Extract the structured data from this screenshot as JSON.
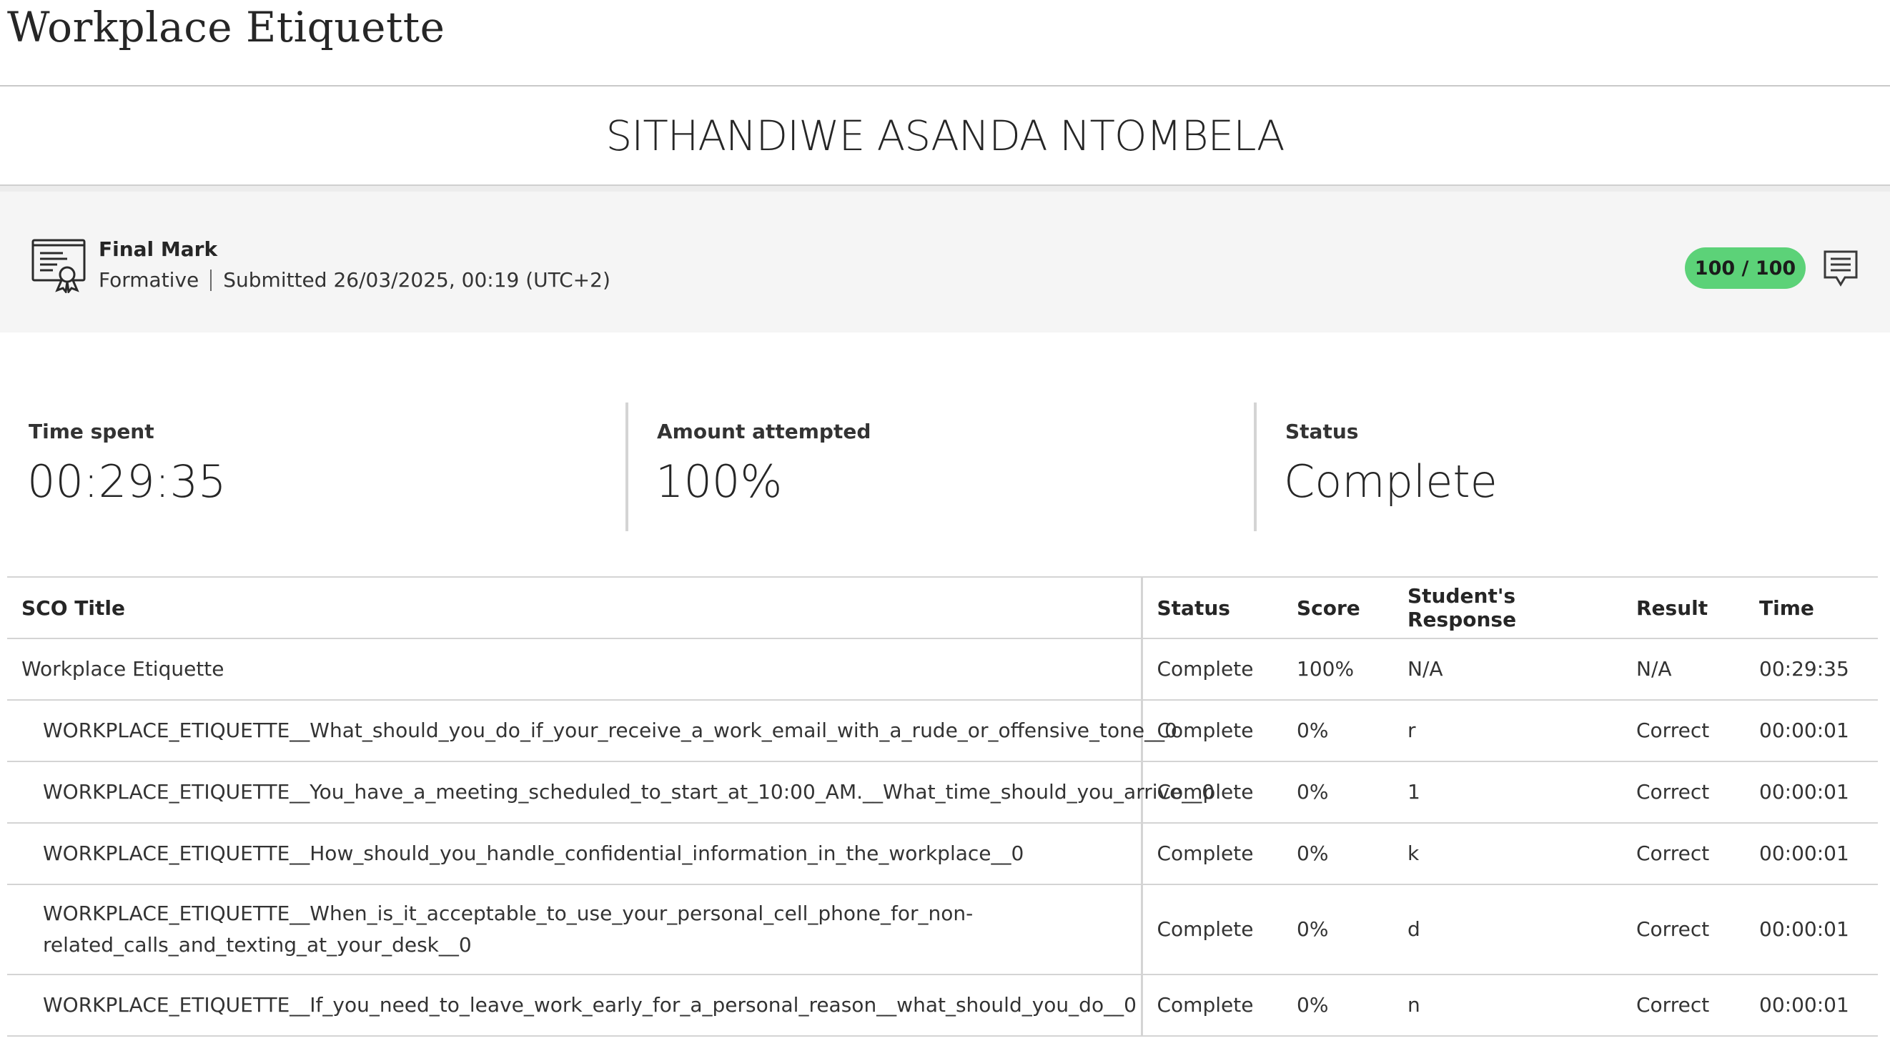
{
  "page": {
    "title": "Workplace Etiquette"
  },
  "student": {
    "name": "SITHANDIWE ASANDA NTOMBELA"
  },
  "final_mark": {
    "label": "Final Mark",
    "type": "Formative",
    "submitted": "Submitted 26/03/2025, 00:19 (UTC+2)",
    "score": "100 / 100",
    "score_color": "#5cd278"
  },
  "stats": {
    "time_spent": {
      "label": "Time spent",
      "value": "00:29:35"
    },
    "amount_attempted": {
      "label": "Amount attempted",
      "value": "100%"
    },
    "status": {
      "label": "Status",
      "value": "Complete"
    }
  },
  "table": {
    "headers": {
      "sco_title": "SCO Title",
      "status": "Status",
      "score": "Score",
      "response": "Student's Response",
      "result": "Result",
      "time": "Time"
    },
    "rows": [
      {
        "title": "Workplace Etiquette",
        "status": "Complete",
        "score": "100%",
        "response": "N/A",
        "result": "N/A",
        "time": "00:29:35"
      },
      {
        "title": "WORKPLACE_ETIQUETTE__What_should_you_do_if_your_receive_a_work_email_with_a_rude_or_offensive_tone__0",
        "status": "Complete",
        "score": "0%",
        "response": "r",
        "result": "Correct",
        "time": "00:00:01"
      },
      {
        "title": "WORKPLACE_ETIQUETTE__You_have_a_meeting_scheduled_to_start_at_10:00_AM.__What_time_should_you_arrive__0",
        "status": "Complete",
        "score": "0%",
        "response": "1",
        "result": "Correct",
        "time": "00:00:01"
      },
      {
        "title": "WORKPLACE_ETIQUETTE__How_should_you_handle_confidential_information_in_the_workplace__0",
        "status": "Complete",
        "score": "0%",
        "response": "k",
        "result": "Correct",
        "time": "00:00:01"
      },
      {
        "title_line1": "WORKPLACE_ETIQUETTE__When_is_it_acceptable_to_use_your_personal_cell_phone_for_non-",
        "title_line2": "related_calls_and_texting_at_your_desk__0",
        "status": "Complete",
        "score": "0%",
        "response": "d",
        "result": "Correct",
        "time": "00:00:01"
      },
      {
        "title": "WORKPLACE_ETIQUETTE__If_you_need_to_leave_work_early_for_a_personal_reason__what_should_you_do__0",
        "status": "Complete",
        "score": "0%",
        "response": "n",
        "result": "Correct",
        "time": "00:00:01"
      }
    ]
  }
}
